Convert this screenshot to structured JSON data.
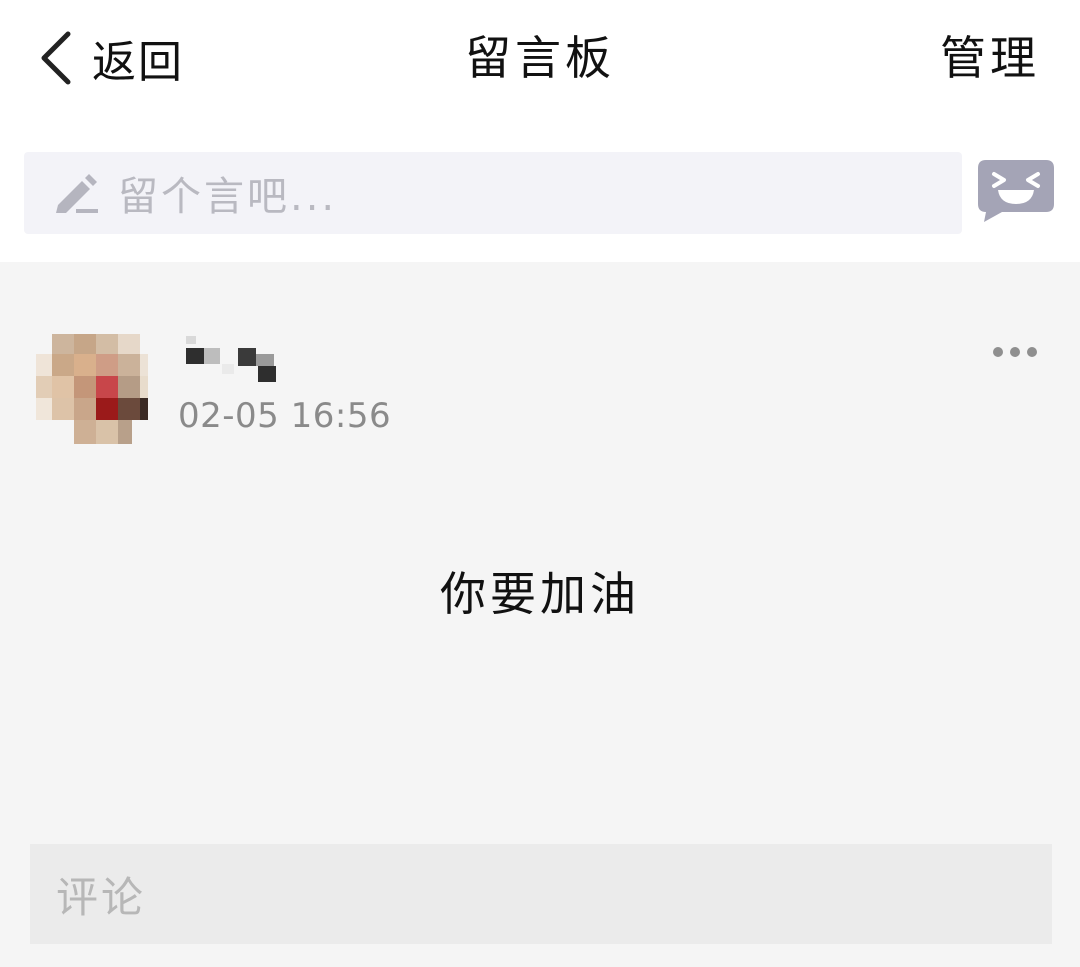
{
  "header": {
    "back_label": "返回",
    "title": "留言板",
    "manage_label": "管理",
    "back_icon": "chevron-left-icon"
  },
  "compose": {
    "placeholder": "留个言吧...",
    "pencil_icon": "pencil-icon",
    "emoji_icon": "emoji-icon",
    "emoji_color": "#a4a4b6"
  },
  "post": {
    "time": "02-05 16:56",
    "content": "你要加油",
    "more_icon": "more-icon"
  },
  "comment": {
    "placeholder": "评论"
  }
}
